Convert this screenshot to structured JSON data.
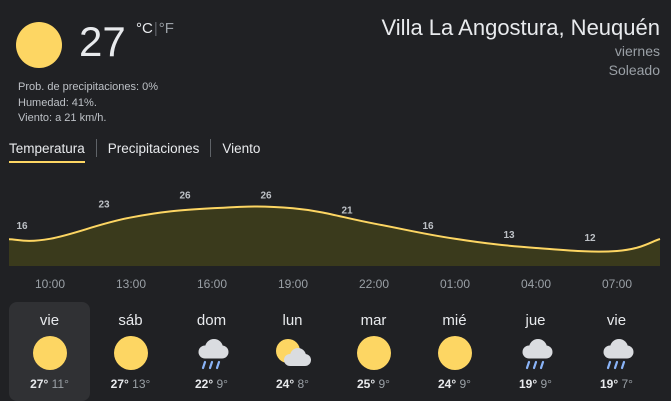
{
  "current": {
    "temp": "27",
    "unit_c": "°C",
    "unit_sep": "|",
    "unit_f": "°F",
    "icon": "sun-icon",
    "precip": "Prob. de precipitaciones: 0%",
    "humidity": "Humedad: 41%.",
    "wind": "Viento: a 21 km/h."
  },
  "location": {
    "city": "Villa La Angostura, Neuquén",
    "day": "viernes",
    "condition": "Soleado"
  },
  "tabs": [
    {
      "label": "Temperatura"
    },
    {
      "label": "Precipitaciones"
    },
    {
      "label": "Viento"
    }
  ],
  "colors": {
    "accent": "#fdd663",
    "area": "#3a3a1c",
    "background": "#202124"
  },
  "chart_data": {
    "type": "area",
    "categories": [
      "10:00",
      "13:00",
      "16:00",
      "19:00",
      "22:00",
      "01:00",
      "04:00",
      "07:00"
    ],
    "values": [
      16,
      23,
      26,
      26,
      21,
      16,
      13,
      12
    ],
    "labels": [
      "16",
      "23",
      "26",
      "26",
      "21",
      "16",
      "13",
      "12"
    ]
  },
  "days": [
    {
      "name": "vie",
      "icon": "sun-icon",
      "hi": "27°",
      "lo": "11°"
    },
    {
      "name": "sáb",
      "icon": "sun-icon",
      "hi": "27°",
      "lo": "13°"
    },
    {
      "name": "dom",
      "icon": "rain-cloud-icon",
      "hi": "22°",
      "lo": "9°"
    },
    {
      "name": "lun",
      "icon": "partly-cloudy-icon",
      "hi": "24°",
      "lo": "8°"
    },
    {
      "name": "mar",
      "icon": "sun-icon",
      "hi": "25°",
      "lo": "9°"
    },
    {
      "name": "mié",
      "icon": "sun-icon",
      "hi": "24°",
      "lo": "9°"
    },
    {
      "name": "jue",
      "icon": "rain-cloud-icon",
      "hi": "19°",
      "lo": "9°"
    },
    {
      "name": "vie",
      "icon": "rain-cloud-icon",
      "hi": "19°",
      "lo": "7°"
    }
  ]
}
